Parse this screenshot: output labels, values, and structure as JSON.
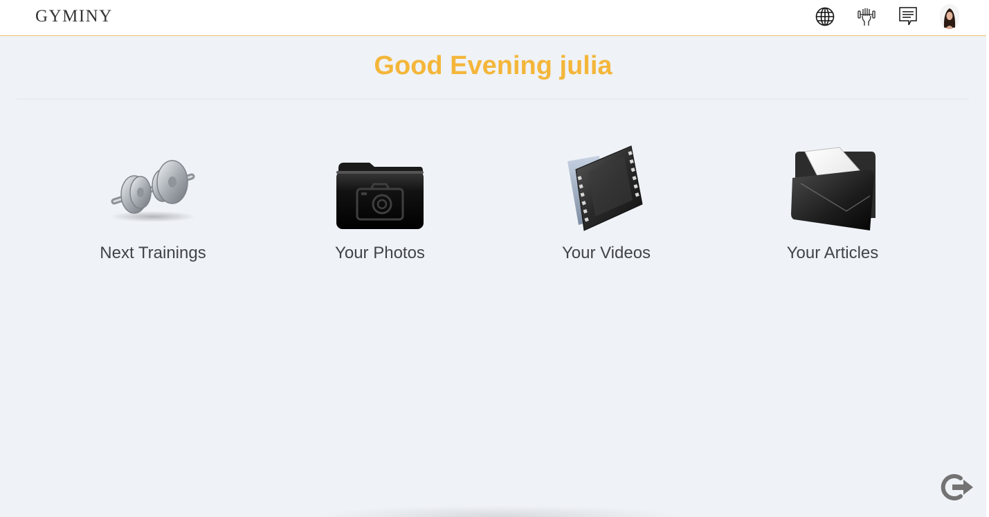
{
  "header": {
    "logo": "GYMINY",
    "icons": [
      "globe-icon",
      "hand-grip-icon",
      "message-icon",
      "user-avatar"
    ]
  },
  "main": {
    "greeting": "Good Evening julia",
    "tiles": [
      {
        "label": "Next Trainings",
        "icon": "dumbbell-icon"
      },
      {
        "label": "Your Photos",
        "icon": "photo-folder-icon"
      },
      {
        "label": "Your Videos",
        "icon": "video-folder-icon"
      },
      {
        "label": "Your Articles",
        "icon": "articles-folder-icon"
      }
    ]
  },
  "footer": {
    "logout_icon": "logout-icon"
  },
  "colors": {
    "accent": "#f4b63a",
    "background": "#eff2f7",
    "header_border": "#e7c36a"
  }
}
